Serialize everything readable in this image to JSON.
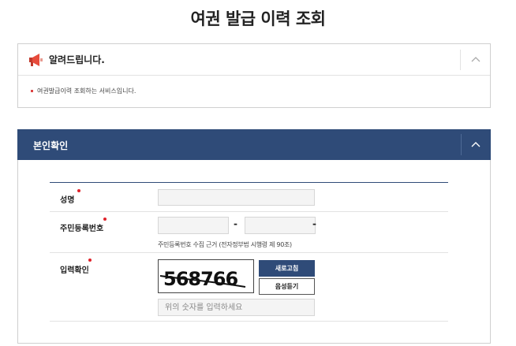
{
  "page": {
    "title": "여권 발급 이력 조회"
  },
  "notice": {
    "title": "알려드립니다.",
    "items": [
      "여권발급이력 조회하는 서비스입니다."
    ]
  },
  "identity": {
    "title": "본인확인",
    "name_label": "성명",
    "rrn_label": "주민등록번호",
    "rrn_separator": "-",
    "rrn_help": "주민등록번호 수집 근거 (전자정부법 시행령 제 90조)",
    "captcha_label": "입력확인",
    "captcha_text": "568766",
    "refresh_button": "새로고침",
    "audio_button": "음성듣기",
    "captcha_placeholder": "위의 숫자를 입력하세요"
  }
}
